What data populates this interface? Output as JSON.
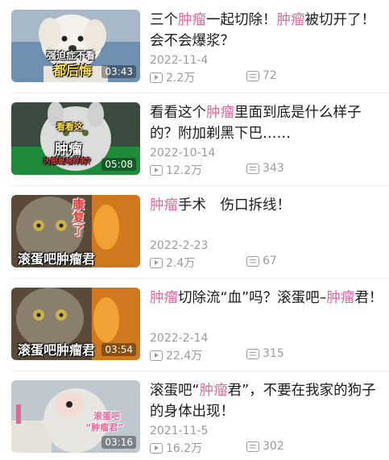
{
  "videos": [
    {
      "title_parts": [
        {
          "text": "三个",
          "hl": false
        },
        {
          "text": "肿瘤",
          "hl": true
        },
        {
          "text": "一起切除！",
          "hl": false
        },
        {
          "text": "肿瘤",
          "hl": true
        },
        {
          "text": "被切开了！会不会爆浆？",
          "hl": false
        }
      ],
      "date": "2022-11-4",
      "views": "2.2万",
      "comments": "72",
      "duration": "03:43",
      "overlay": [
        "强迫症不看",
        "都后悔"
      ]
    },
    {
      "title_parts": [
        {
          "text": "看看这个",
          "hl": false
        },
        {
          "text": "肿瘤",
          "hl": true
        },
        {
          "text": "里面到底是什么样子的？附加剃黑下巴……",
          "hl": false
        }
      ],
      "date": "2022-10-14",
      "views": "12.2万",
      "comments": "343",
      "duration": "05:08",
      "overlay": [
        "看看这",
        "肿瘤",
        "内部是啥样的？"
      ]
    },
    {
      "title_parts": [
        {
          "text": "肿瘤",
          "hl": true
        },
        {
          "text": "手术　伤口拆线！",
          "hl": false
        }
      ],
      "date": "2022-2-23",
      "views": "2.4万",
      "comments": "67",
      "duration": "",
      "overlay": [
        "康复了",
        "滚蛋吧肿瘤君"
      ]
    },
    {
      "title_parts": [
        {
          "text": "肿瘤",
          "hl": true
        },
        {
          "text": "切除流“血”吗？滚蛋吧–",
          "hl": false
        },
        {
          "text": "肿瘤",
          "hl": true
        },
        {
          "text": "君！",
          "hl": false
        }
      ],
      "date": "2022-2-14",
      "views": "22.4万",
      "comments": "315",
      "duration": "03:54",
      "overlay": [
        "滚蛋吧肿瘤君"
      ]
    },
    {
      "title_parts": [
        {
          "text": "滚蛋吧“",
          "hl": false
        },
        {
          "text": "肿瘤",
          "hl": true
        },
        {
          "text": "君”，不要在我家的狗子的身体出现！",
          "hl": false
        }
      ],
      "date": "2021-11-5",
      "views": "16.2万",
      "comments": "302",
      "duration": "03:16",
      "overlay": [
        "滚蛋吧",
        "“肿瘤君”"
      ]
    }
  ],
  "colors": {
    "highlight": "#e8679a",
    "meta": "#9a9a9a",
    "overlay_accent": "#e23b3b"
  },
  "icons": {
    "views": "play-count-icon",
    "comments": "comment-count-icon"
  }
}
